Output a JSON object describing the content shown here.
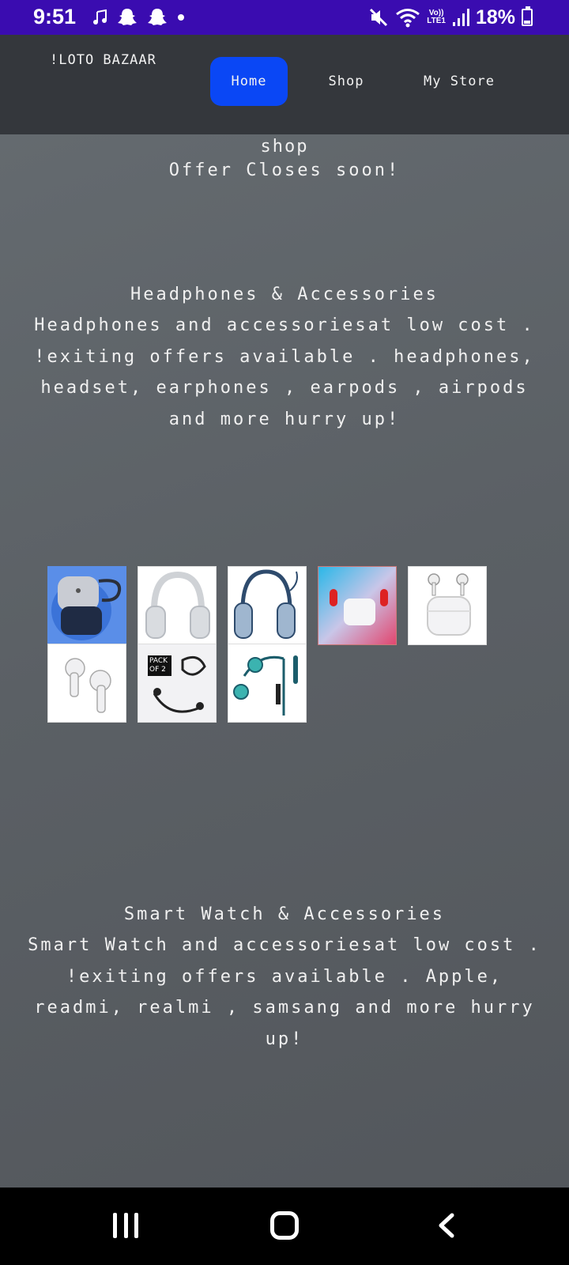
{
  "status_bar": {
    "time": "9:51",
    "lte_top": "Vo))",
    "lte_bottom": "LTE1",
    "battery": "18%",
    "icons": [
      "music-note-icon",
      "snapchat-icon",
      "snapchat-icon",
      "dot-icon",
      "mute-icon",
      "wifi-icon",
      "signal-icon",
      "battery-icon"
    ]
  },
  "header": {
    "brand": "!LOTO BAZAAR",
    "nav": [
      {
        "label": "Home",
        "active": true
      },
      {
        "label": "Shop",
        "active": false
      },
      {
        "label": "My Store",
        "active": false
      }
    ],
    "accent_color": "#0a47f5"
  },
  "main": {
    "shop_label": "shop",
    "offer_text": "Offer Closes soon!",
    "sections": [
      {
        "title": "Headphones & Accessories",
        "description": "Headphones and accessoriesat low cost . !exiting offers available . headphones, headset, earphones , earpods , airpods and more hurry up!",
        "products": [
          {
            "name": "airpods-case-image",
            "badge": ""
          },
          {
            "name": "over-ear-headphones-silver-image",
            "badge": ""
          },
          {
            "name": "over-ear-headphones-blue-image",
            "badge": ""
          },
          {
            "name": "airpods-red-blue-image",
            "badge": ""
          },
          {
            "name": "airpods-3-image",
            "badge": ""
          },
          {
            "name": "airpods-pro-image",
            "badge": ""
          },
          {
            "name": "wired-earphones-pack-image",
            "badge": "PACK OF 2"
          },
          {
            "name": "teal-earphones-image",
            "badge": ""
          }
        ]
      },
      {
        "title": "Smart Watch & Accessories",
        "description": "Smart Watch and accessoriesat low cost . !exiting offers available . Apple, readmi, realmi , samsang and more hurry up!"
      }
    ]
  }
}
